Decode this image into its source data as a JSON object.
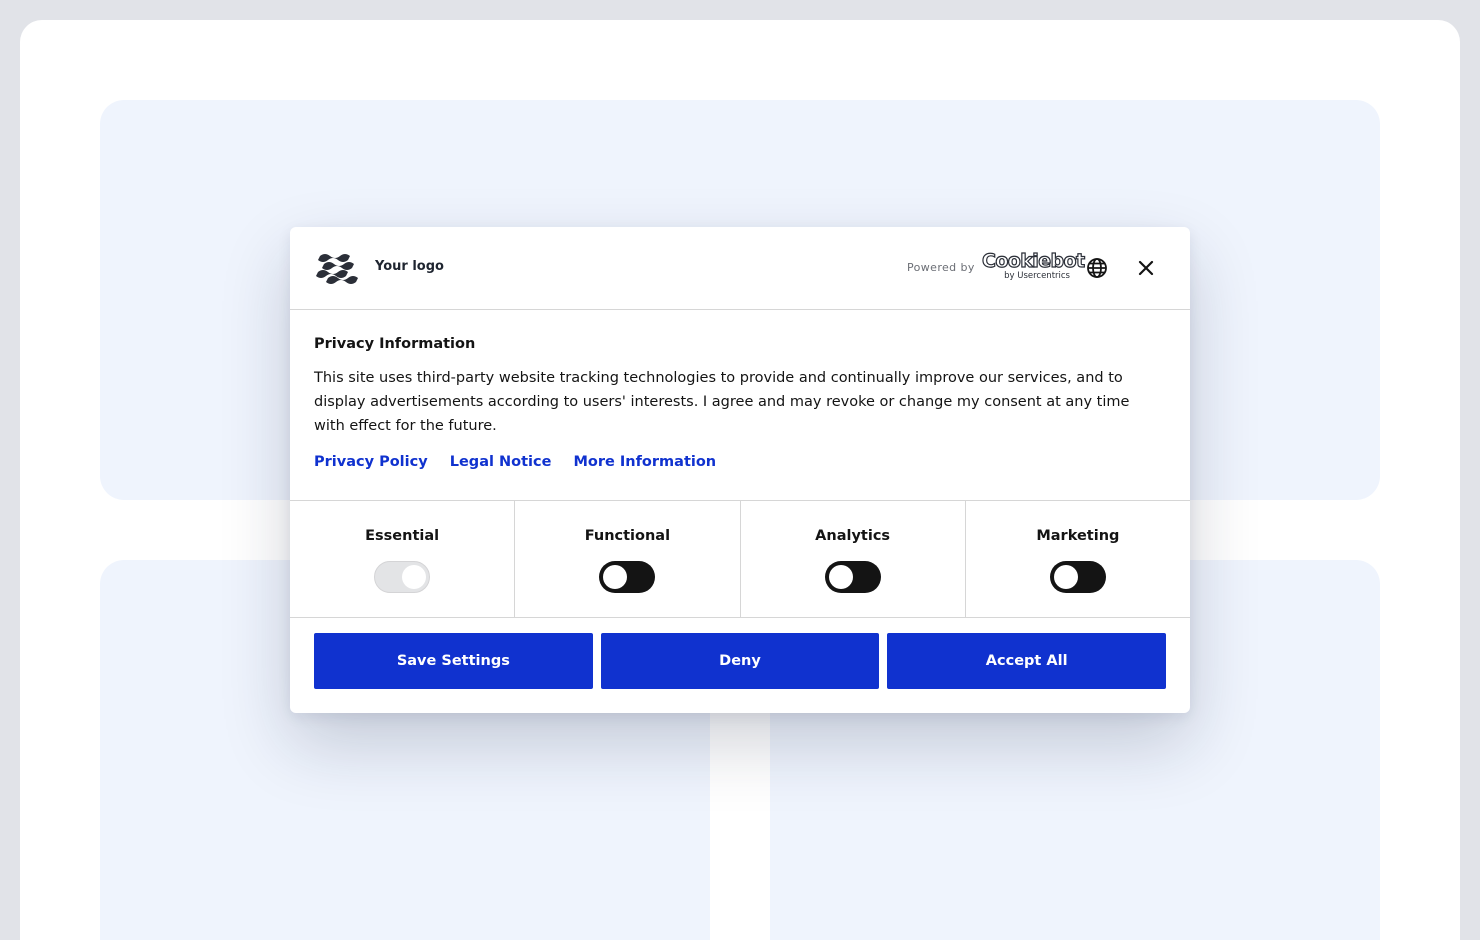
{
  "brand": {
    "logo_text": "Your logo"
  },
  "header": {
    "powered_by": "Powered by",
    "provider_name": "Cookiebot",
    "provider_sub": "by Usercentrics"
  },
  "content": {
    "title": "Privacy Information",
    "description": "This site uses third-party website tracking technologies to provide and continually improve our services, and to display advertisements according to users' interests. I agree and may revoke or change my consent at any time with effect for the future.",
    "links": [
      "Privacy Policy",
      "Legal Notice",
      "More Information"
    ]
  },
  "categories": [
    {
      "label": "Essential",
      "enabled": true,
      "locked": true
    },
    {
      "label": "Functional",
      "enabled": false,
      "locked": false
    },
    {
      "label": "Analytics",
      "enabled": false,
      "locked": false
    },
    {
      "label": "Marketing",
      "enabled": false,
      "locked": false
    }
  ],
  "buttons": {
    "save": "Save Settings",
    "deny": "Deny",
    "accept": "Accept All"
  },
  "colors": {
    "primary": "#1032cf",
    "background_panel": "#eff4fd",
    "toggle_off": "#141414"
  },
  "icons": [
    "logo-icon",
    "globe-icon",
    "close-icon"
  ]
}
